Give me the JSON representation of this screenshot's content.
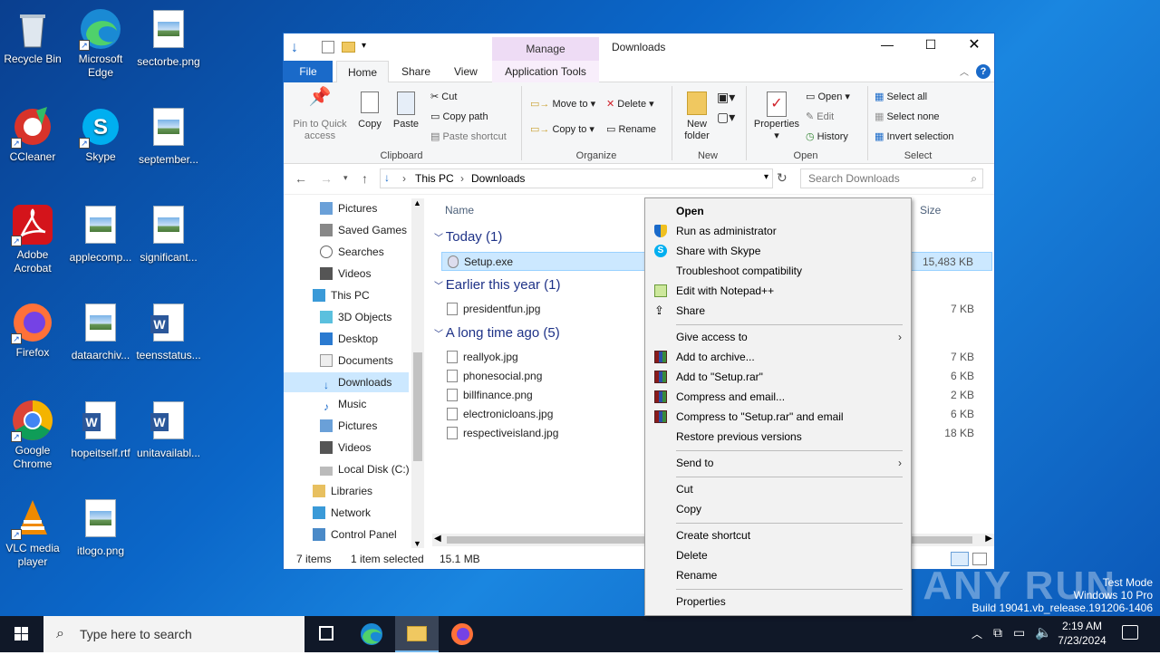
{
  "desktop": {
    "icons": [
      {
        "label": "Recycle Bin"
      },
      {
        "label": "Microsoft Edge"
      },
      {
        "label": "sectorbe.png"
      },
      {
        "label": "CCleaner"
      },
      {
        "label": "Skype"
      },
      {
        "label": "september..."
      },
      {
        "label": "Adobe Acrobat"
      },
      {
        "label": "applecomp..."
      },
      {
        "label": "significant..."
      },
      {
        "label": "Firefox"
      },
      {
        "label": "dataarchiv..."
      },
      {
        "label": "teensstatus..."
      },
      {
        "label": "Google Chrome"
      },
      {
        "label": "hopeitself.rtf"
      },
      {
        "label": "unitavailabl..."
      },
      {
        "label": "VLC media player"
      },
      {
        "label": "itlogo.png"
      }
    ]
  },
  "explorer": {
    "title": "Downloads",
    "manage_label": "Manage",
    "tabs": [
      "File",
      "Home",
      "Share",
      "View",
      "Application Tools"
    ],
    "ribbon": {
      "clipboard": {
        "label": "Clipboard",
        "pin": "Pin to Quick access",
        "copy": "Copy",
        "paste": "Paste",
        "cut": "Cut",
        "copy_path": "Copy path",
        "paste_shortcut": "Paste shortcut"
      },
      "organize": {
        "label": "Organize",
        "move_to": "Move to",
        "copy_to": "Copy to",
        "delete": "Delete",
        "rename": "Rename"
      },
      "new": {
        "label": "New",
        "new_folder": "New folder"
      },
      "open": {
        "label": "Open",
        "properties": "Properties",
        "open": "Open",
        "edit": "Edit",
        "history": "History"
      },
      "select": {
        "label": "Select",
        "select_all": "Select all",
        "select_none": "Select none",
        "invert": "Invert selection"
      }
    },
    "address": {
      "crumbs": [
        "This PC",
        "Downloads"
      ],
      "search_placeholder": "Search Downloads"
    },
    "nav": [
      "Pictures",
      "Saved Games",
      "Searches",
      "Videos",
      "This PC",
      "3D Objects",
      "Desktop",
      "Documents",
      "Downloads",
      "Music",
      "Pictures",
      "Videos",
      "Local Disk (C:)",
      "Libraries",
      "Network",
      "Control Panel"
    ],
    "columns": {
      "name": "Name",
      "size": "Size"
    },
    "groups": [
      {
        "label": "Today (1)",
        "files": [
          {
            "name": "Setup.exe",
            "size": "15,483 KB"
          }
        ]
      },
      {
        "label": "Earlier this year (1)",
        "files": [
          {
            "name": "presidentfun.jpg",
            "size": "7 KB"
          }
        ]
      },
      {
        "label": "A long time ago (5)",
        "files": [
          {
            "name": "reallyok.jpg",
            "size": "7 KB"
          },
          {
            "name": "phonesocial.png",
            "size": "6 KB"
          },
          {
            "name": "billfinance.png",
            "size": "2 KB"
          },
          {
            "name": "electronicloans.jpg",
            "size": "6 KB"
          },
          {
            "name": "respectiveisland.jpg",
            "size": "18 KB"
          }
        ]
      }
    ],
    "status": {
      "items": "7 items",
      "selected": "1 item selected",
      "size": "15.1 MB"
    }
  },
  "context_menu": {
    "items": [
      "Open",
      "Run as administrator",
      "Share with Skype",
      "Troubleshoot compatibility",
      "Edit with Notepad++",
      "Share",
      "Give access to",
      "Add to archive...",
      "Add to \"Setup.rar\"",
      "Compress and email...",
      "Compress to \"Setup.rar\" and email",
      "Restore previous versions",
      "Send to",
      "Cut",
      "Copy",
      "Create shortcut",
      "Delete",
      "Rename",
      "Properties"
    ]
  },
  "taskbar": {
    "search_placeholder": "Type here to search",
    "time": "2:19 AM",
    "date": "7/23/2024"
  },
  "watermark": {
    "line1": "Test Mode",
    "line2": "Windows 10 Pro",
    "line3": "Build 19041.vb_release.191206-1406",
    "brand": "ANY RUN"
  },
  "colors": {
    "accent": "#0078d7",
    "manage_tab": "#e6c8f0",
    "selection": "#cce8ff"
  }
}
